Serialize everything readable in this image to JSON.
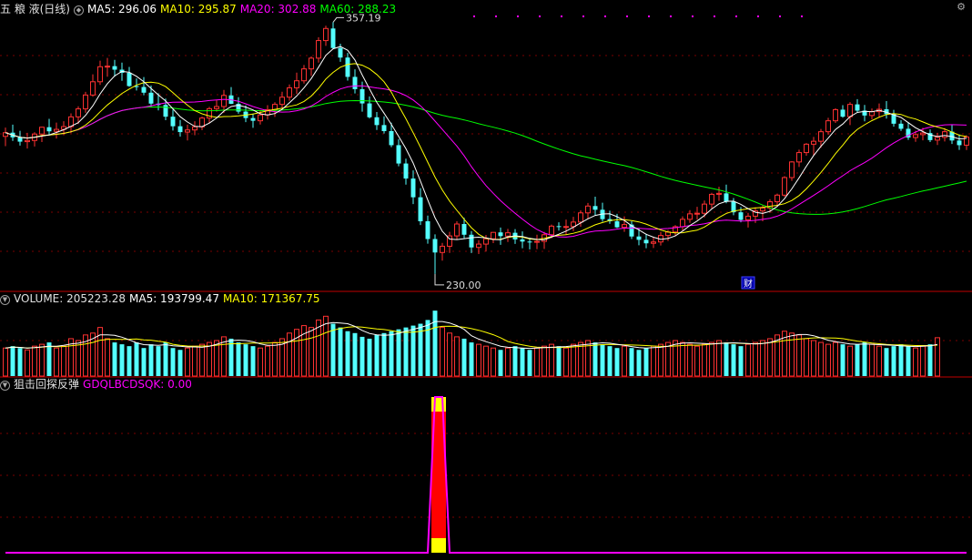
{
  "header": {
    "stock_name": "五 粮 液(日线)",
    "ma5_label": "MA5: 296.06",
    "ma10_label": "MA10: 295.87",
    "ma20_label": "MA20: 302.88",
    "ma60_label": "MA60: 288.23"
  },
  "volume_header": {
    "volume_label": "VOLUME: 205223.28",
    "ma5_label": "MA5: 193799.47",
    "ma10_label": "MA10: 171367.75"
  },
  "indicator_header": {
    "name": "狙击回探反弹",
    "value_label": "GDQLBCDSQK: 0.00"
  },
  "annotations": {
    "high_label": "357.19",
    "low_label": "230.00",
    "finance_marker": "财"
  },
  "colors": {
    "background": "#000000",
    "up": "#ff3232",
    "down": "#54ffff",
    "ma5": "#ffffff",
    "ma10": "#ffff00",
    "ma20": "#ff00ff",
    "ma60": "#00ff00",
    "grid": "#7a0000",
    "indicator_line": "#ff00ff",
    "signal_red": "#ff0000",
    "signal_yellow": "#ffff00"
  },
  "chart_data": {
    "type": "candlestick",
    "ylim": [
      222,
      362
    ],
    "volume_ylim": [
      0,
      380000
    ],
    "high": 357.19,
    "low": 230.0,
    "ohlc": [
      [
        300.5,
        305.0,
        295.5,
        302.4
      ],
      [
        302.4,
        306.5,
        298.2,
        300.0
      ],
      [
        300.0,
        303.4,
        295.8,
        297.8
      ],
      [
        297.8,
        302.3,
        294.3,
        298.4
      ],
      [
        298.4,
        302.6,
        295.3,
        301.7
      ],
      [
        301.7,
        305.4,
        297.6,
        305.2
      ],
      [
        305.2,
        309.5,
        301.0,
        303.1
      ],
      [
        303.1,
        307.6,
        299.4,
        304.1
      ],
      [
        304.1,
        308.3,
        301.1,
        305.5
      ],
      [
        305.5,
        312.3,
        302.2,
        310.5
      ],
      [
        310.5,
        315.9,
        306.8,
        314.6
      ],
      [
        314.6,
        323.3,
        312.6,
        321.7
      ],
      [
        321.7,
        332.3,
        320.8,
        328.5
      ],
      [
        328.5,
        339.3,
        326.9,
        336.2
      ],
      [
        336.2,
        340.7,
        331.1,
        336.5
      ],
      [
        336.5,
        339.7,
        331.1,
        334.7
      ],
      [
        334.7,
        338.3,
        329.0,
        333.1
      ],
      [
        333.1,
        336.1,
        325.9,
        326.3
      ],
      [
        326.3,
        330.2,
        324.0,
        325.8
      ],
      [
        325.8,
        330.9,
        321.6,
        322.9
      ],
      [
        322.9,
        326.6,
        315.6,
        317.3
      ],
      [
        317.3,
        322.6,
        313.8,
        316.6
      ],
      [
        316.6,
        319.9,
        308.8,
        310.6
      ],
      [
        310.6,
        314.2,
        303.5,
        305.7
      ],
      [
        305.7,
        308.9,
        300.4,
        302.7
      ],
      [
        302.7,
        306.5,
        298.4,
        303.8
      ],
      [
        303.8,
        308.3,
        301.1,
        305.4
      ],
      [
        305.4,
        310.6,
        303.7,
        309.9
      ],
      [
        309.9,
        315.6,
        307.4,
        314.7
      ],
      [
        314.7,
        319.0,
        313.2,
        315.8
      ],
      [
        315.8,
        324.3,
        312.6,
        321.5
      ],
      [
        321.5,
        325.8,
        317.0,
        317.2
      ],
      [
        317.2,
        320.6,
        312.1,
        313.2
      ],
      [
        313.2,
        316.4,
        307.8,
        309.9
      ],
      [
        309.9,
        312.2,
        304.9,
        308.5
      ],
      [
        308.5,
        313.6,
        306.6,
        311.5
      ],
      [
        311.5,
        316.5,
        309.1,
        314.2
      ],
      [
        314.2,
        318.0,
        310.5,
        316.9
      ],
      [
        316.9,
        323.4,
        314.8,
        320.6
      ],
      [
        320.6,
        327.1,
        318.8,
        325.4
      ],
      [
        325.4,
        333.2,
        322.2,
        329.0
      ],
      [
        329.0,
        337.1,
        327.6,
        335.1
      ],
      [
        335.1,
        341.5,
        331.5,
        340.6
      ],
      [
        340.6,
        351.3,
        338.3,
        349.6
      ],
      [
        349.6,
        357.19,
        346.9,
        355.8
      ],
      [
        355.8,
        359.0,
        345.2,
        345.8
      ],
      [
        345.8,
        348.0,
        338.7,
        340.9
      ],
      [
        340.9,
        343.3,
        329.1,
        331.0
      ],
      [
        331.0,
        334.9,
        322.5,
        324.7
      ],
      [
        324.7,
        328.6,
        313.2,
        317.4
      ],
      [
        317.4,
        321.0,
        309.7,
        310.3
      ],
      [
        310.3,
        313.0,
        303.8,
        306.3
      ],
      [
        306.3,
        310.8,
        302.0,
        303.2
      ],
      [
        303.2,
        307.5,
        295.0,
        296.0
      ],
      [
        296.0,
        299.1,
        285.2,
        286.6
      ],
      [
        286.6,
        289.1,
        275.8,
        278.9
      ],
      [
        278.9,
        283.1,
        265.8,
        269.3
      ],
      [
        269.3,
        274.0,
        255.1,
        257.0
      ],
      [
        257.0,
        259.9,
        245.5,
        247.9
      ],
      [
        247.9,
        250.3,
        230.0,
        241.0
      ],
      [
        241.0,
        245.9,
        236.8,
        244.2
      ],
      [
        244.2,
        251.6,
        240.8,
        249.5
      ],
      [
        249.5,
        257.0,
        247.6,
        255.6
      ],
      [
        255.6,
        258.8,
        248.3,
        250.1
      ],
      [
        250.1,
        252.0,
        240.7,
        243.6
      ],
      [
        243.6,
        247.3,
        240.2,
        245.3
      ],
      [
        245.3,
        250.0,
        241.5,
        248.0
      ],
      [
        248.0,
        251.5,
        245.8,
        251.3
      ],
      [
        251.3,
        253.8,
        244.9,
        249.4
      ],
      [
        249.4,
        253.1,
        246.4,
        251.1
      ],
      [
        251.1,
        253.0,
        245.4,
        247.7
      ],
      [
        247.7,
        251.8,
        243.2,
        246.6
      ],
      [
        246.6,
        248.5,
        242.6,
        246.4
      ],
      [
        246.4,
        250.1,
        242.7,
        246.7
      ],
      [
        246.7,
        251.6,
        242.8,
        250.1
      ],
      [
        250.1,
        255.3,
        248.3,
        254.5
      ],
      [
        254.5,
        256.5,
        252.2,
        254.2
      ],
      [
        254.2,
        257.9,
        250.1,
        254.3
      ],
      [
        254.3,
        259.3,
        251.9,
        256.6
      ],
      [
        256.6,
        262.6,
        254.2,
        261.3
      ],
      [
        261.3,
        266.4,
        258.4,
        264.8
      ],
      [
        264.8,
        269.6,
        260.1,
        262.9
      ],
      [
        262.9,
        266.5,
        256.8,
        258.1
      ],
      [
        258.1,
        262.4,
        255.7,
        257.0
      ],
      [
        257.0,
        260.8,
        253.5,
        253.9
      ],
      [
        253.9,
        259.5,
        251.6,
        255.3
      ],
      [
        255.3,
        257.0,
        247.9,
        249.2
      ],
      [
        249.2,
        253.4,
        244.7,
        247.5
      ],
      [
        247.5,
        250.6,
        243.2,
        245.7
      ],
      [
        245.7,
        248.8,
        243.3,
        246.4
      ],
      [
        246.4,
        251.6,
        244.6,
        249.7
      ],
      [
        249.7,
        252.5,
        246.9,
        251.5
      ],
      [
        251.5,
        255.0,
        249.6,
        254.2
      ],
      [
        254.2,
        259.5,
        252.2,
        258.0
      ],
      [
        258.0,
        262.7,
        256.2,
        260.8
      ],
      [
        260.8,
        264.4,
        257.9,
        261.1
      ],
      [
        261.1,
        267.6,
        259.0,
        265.8
      ],
      [
        265.8,
        271.6,
        263.5,
        270.8
      ],
      [
        270.8,
        274.7,
        267.5,
        271.3
      ],
      [
        271.3,
        275.8,
        266.2,
        267.0
      ],
      [
        267.0,
        268.9,
        260.1,
        261.6
      ],
      [
        261.6,
        264.3,
        256.5,
        257.7
      ],
      [
        257.7,
        261.3,
        253.8,
        259.6
      ],
      [
        259.6,
        264.2,
        256.1,
        262.3
      ],
      [
        262.3,
        265.4,
        257.0,
        263.8
      ],
      [
        263.8,
        268.3,
        261.3,
        267.0
      ],
      [
        267.0,
        271.2,
        265.1,
        270.4
      ],
      [
        270.4,
        280.1,
        269.5,
        279.4
      ],
      [
        279.4,
        287.8,
        277.7,
        287.4
      ],
      [
        287.4,
        293.7,
        284.8,
        292.2
      ],
      [
        292.2,
        297.1,
        290.6,
        296.5
      ],
      [
        296.5,
        300.2,
        290.7,
        298.0
      ],
      [
        298.0,
        304.3,
        294.7,
        302.9
      ],
      [
        302.9,
        310.0,
        301.4,
        308.5
      ],
      [
        308.5,
        314.9,
        307.4,
        314.2
      ],
      [
        314.2,
        316.5,
        310.1,
        310.6
      ],
      [
        310.6,
        318.0,
        306.3,
        316.9
      ],
      [
        316.9,
        319.6,
        313.0,
        313.7
      ],
      [
        313.7,
        316.6,
        308.2,
        311.2
      ],
      [
        311.2,
        314.8,
        309.2,
        313.2
      ],
      [
        313.2,
        317.4,
        310.0,
        314.4
      ],
      [
        314.4,
        318.6,
        309.6,
        311.9
      ],
      [
        311.9,
        314.1,
        305.5,
        307.0
      ],
      [
        307.0,
        308.8,
        303.3,
        304.4
      ],
      [
        304.4,
        307.8,
        298.7,
        299.9
      ],
      [
        299.9,
        303.4,
        297.7,
        301.4
      ],
      [
        301.4,
        304.9,
        298.5,
        302.2
      ],
      [
        302.2,
        304.1,
        297.6,
        298.6
      ],
      [
        298.6,
        302.3,
        296.1,
        300.0
      ],
      [
        300.0,
        304.7,
        297.9,
        302.9
      ],
      [
        302.9,
        306.5,
        296.6,
        298.4
      ],
      [
        298.4,
        301.5,
        293.6,
        296.0
      ],
      [
        296.0,
        301.1,
        293.5,
        300.2
      ]
    ],
    "volume": [
      150000,
      160000,
      150000,
      140000,
      160000,
      170000,
      180000,
      150000,
      160000,
      200000,
      190000,
      220000,
      230000,
      260000,
      200000,
      180000,
      170000,
      160000,
      180000,
      150000,
      170000,
      160000,
      180000,
      150000,
      140000,
      150000,
      160000,
      170000,
      180000,
      190000,
      210000,
      200000,
      180000,
      170000,
      160000,
      150000,
      160000,
      180000,
      200000,
      230000,
      250000,
      270000,
      260000,
      300000,
      320000,
      280000,
      260000,
      240000,
      230000,
      210000,
      200000,
      220000,
      230000,
      240000,
      250000,
      260000,
      270000,
      280000,
      300000,
      350000,
      260000,
      230000,
      210000,
      200000,
      180000,
      170000,
      160000,
      150000,
      140000,
      150000,
      160000,
      150000,
      140000,
      150000,
      160000,
      170000,
      160000,
      150000,
      170000,
      180000,
      190000,
      180000,
      170000,
      160000,
      150000,
      160000,
      150000,
      140000,
      150000,
      160000,
      170000,
      180000,
      190000,
      180000,
      170000,
      160000,
      170000,
      180000,
      190000,
      180000,
      170000,
      160000,
      170000,
      180000,
      190000,
      200000,
      220000,
      240000,
      230000,
      220000,
      200000,
      190000,
      180000,
      170000,
      180000,
      170000,
      160000,
      170000,
      180000,
      170000,
      160000,
      150000,
      160000,
      170000,
      160000,
      150000,
      160000,
      170000,
      205223
    ],
    "indicator": {
      "name": "GDQLBCDSQK",
      "signal_index": 59,
      "value": 0.0
    }
  }
}
